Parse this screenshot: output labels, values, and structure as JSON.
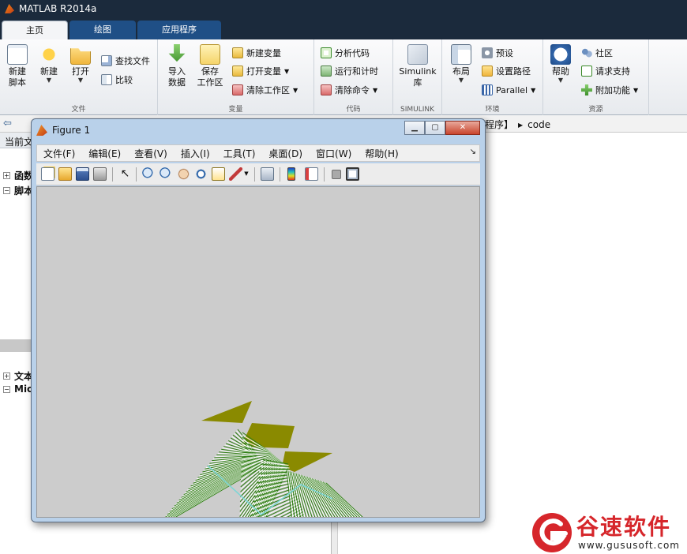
{
  "app": {
    "title": "MATLAB R2014a"
  },
  "tabs": [
    {
      "label": "主页",
      "active": true
    },
    {
      "label": "绘图",
      "active": false
    },
    {
      "label": "应用程序",
      "active": false
    }
  ],
  "ribbon": {
    "file": {
      "label": "文件",
      "new_script": [
        "新建",
        "脚本"
      ],
      "new": "新建",
      "open": "打开",
      "find_files": "查找文件",
      "compare": "比较"
    },
    "variable": {
      "label": "变量",
      "import": [
        "导入",
        "数据"
      ],
      "save_ws": [
        "保存",
        "工作区"
      ],
      "new_var": "新建变量",
      "open_var": "打开变量",
      "clear_ws": "清除工作区"
    },
    "code": {
      "label": "代码",
      "analyze": "分析代码",
      "run_time": "运行和计时",
      "clear_cmd": "清除命令"
    },
    "simulink": {
      "label": "SIMULINK",
      "btn": [
        "Simulink",
        "库"
      ]
    },
    "env": {
      "label": "环境",
      "layout": "布局",
      "prefs": "预设",
      "set_path": "设置路径",
      "parallel": "Parallel"
    },
    "resources": {
      "label": "资源",
      "help": "帮助",
      "community": "社区",
      "support": "请求支持",
      "addons": "附加功能"
    }
  },
  "address": {
    "tail": "程序】",
    "current": "code"
  },
  "current_folder": {
    "header": "当前文",
    "rows": [
      "函数",
      "脚本",
      "文本",
      "Mic"
    ]
  },
  "figure": {
    "title": "Figure 1",
    "menu": [
      "文件(F)",
      "编辑(E)",
      "查看(V)",
      "插入(I)",
      "工具(T)",
      "桌面(D)",
      "窗口(W)",
      "帮助(H)"
    ],
    "canvas_bg": "#cccccc",
    "surface_colors": {
      "green": "#2e7d12",
      "olive": "#8a8a00",
      "cyan": "#7ad6d6"
    }
  },
  "watermark": {
    "cn": "谷速软件",
    "url": "www.gususoft.com",
    "color": "#d6262b"
  },
  "colors": {
    "title_bar": "#1b2a3c",
    "tab_blue": "#1f4f86"
  },
  "icons": {
    "new_script": "new-script-icon",
    "new": "new-star-icon",
    "open": "open-folder-icon",
    "import": "import-arrow-icon",
    "save": "save-icon",
    "simulink": "simulink-icon",
    "layout": "layout-icon",
    "help": "help-icon"
  }
}
